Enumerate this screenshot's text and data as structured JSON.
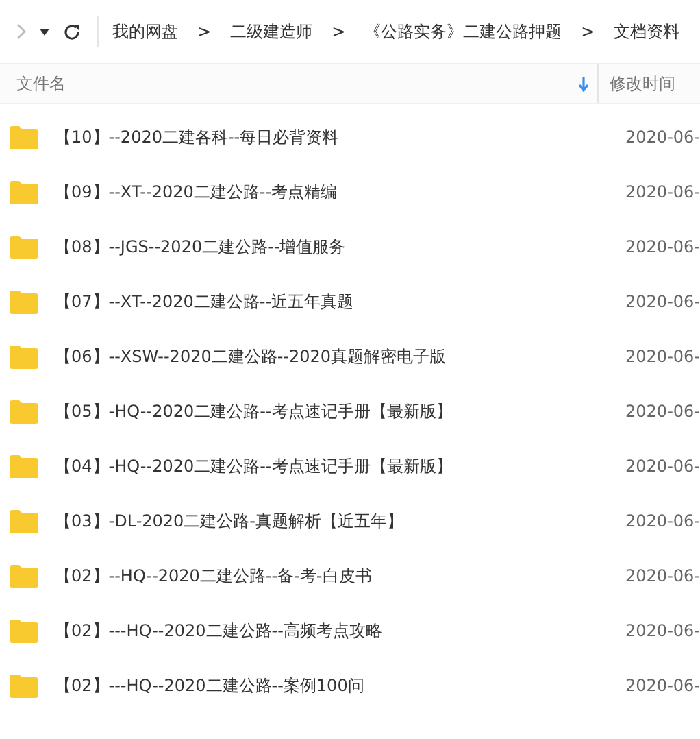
{
  "toolbar": {
    "path": [
      "我的网盘",
      "二级建造师",
      "《公路实务》二建公路押题",
      "文档资料"
    ],
    "separator": ">"
  },
  "table": {
    "columns": [
      {
        "label": "文件名",
        "sort_descending": true
      },
      {
        "label": "修改时间"
      }
    ],
    "rows": [
      {
        "name": "【10】--2020二建各科--每日必背资料",
        "modified": "2020-06-"
      },
      {
        "name": "【09】--XT--2020二建公路--考点精编",
        "modified": "2020-06-"
      },
      {
        "name": "【08】--JGS--2020二建公路--增值服务",
        "modified": "2020-06-"
      },
      {
        "name": "【07】--XT--2020二建公路--近五年真题",
        "modified": "2020-06-"
      },
      {
        "name": "【06】--XSW--2020二建公路--2020真题解密电子版",
        "modified": "2020-06-"
      },
      {
        "name": "【05】-HQ--2020二建公路--考点速记手册【最新版】",
        "modified": "2020-06-"
      },
      {
        "name": "【04】-HQ--2020二建公路--考点速记手册【最新版】",
        "modified": "2020-06-"
      },
      {
        "name": "【03】-DL-2020二建公路-真题解析【近五年】",
        "modified": "2020-06-"
      },
      {
        "name": "【02】--HQ--2020二建公路--备-考-白皮书",
        "modified": "2020-06-"
      },
      {
        "name": "【02】---HQ--2020二建公路--高频考点攻略",
        "modified": "2020-06-"
      },
      {
        "name": "【02】---HQ--2020二建公路--案例100问",
        "modified": "2020-06-"
      }
    ]
  }
}
